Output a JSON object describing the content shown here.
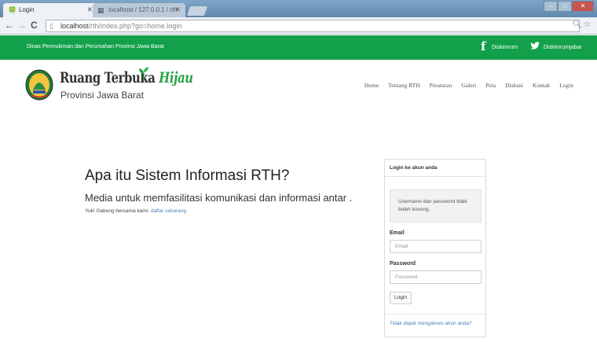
{
  "browser": {
    "tabs": [
      {
        "title": "Login",
        "active": true
      },
      {
        "title": "localhost / 127.0.0.1 / rth",
        "active": false
      }
    ],
    "url_host": "localhost",
    "url_path": "/rth/index.php?go=home.login"
  },
  "topbar": {
    "agency": "Dinas Permukiman dan Perumahan Provinsi Jawa Barat",
    "facebook_label": "Diskimrum",
    "twitter_label": "Diskimrumjabar",
    "color": "#12a04a"
  },
  "brand": {
    "title_main": "Ruang Terbuka",
    "title_accent": "Hijau",
    "subtitle": "Provinsi Jawa Barat"
  },
  "nav": [
    "Home",
    "Tentang RTH",
    "Peraturan",
    "Galeri",
    "Peta",
    "Diskusi",
    "Kontak",
    "Login"
  ],
  "hero": {
    "title": "Apa itu Sistem Informasi RTH?",
    "text": "Media untuk memfasilitasi komunikasi dan informasi antar .",
    "small_prefix": "Yuk! Gabung bersama kami.",
    "small_link": "daftar sekarang"
  },
  "login": {
    "heading": "Login ke akun anda",
    "alert_line1": "Username dan password tidak",
    "alert_line2": "boleh kosong.",
    "email_label": "Email",
    "email_placeholder": "Email",
    "password_label": "Password",
    "password_placeholder": "Password",
    "button": "Login",
    "forgot": "Tidak dapat mengakses akun anda?"
  }
}
